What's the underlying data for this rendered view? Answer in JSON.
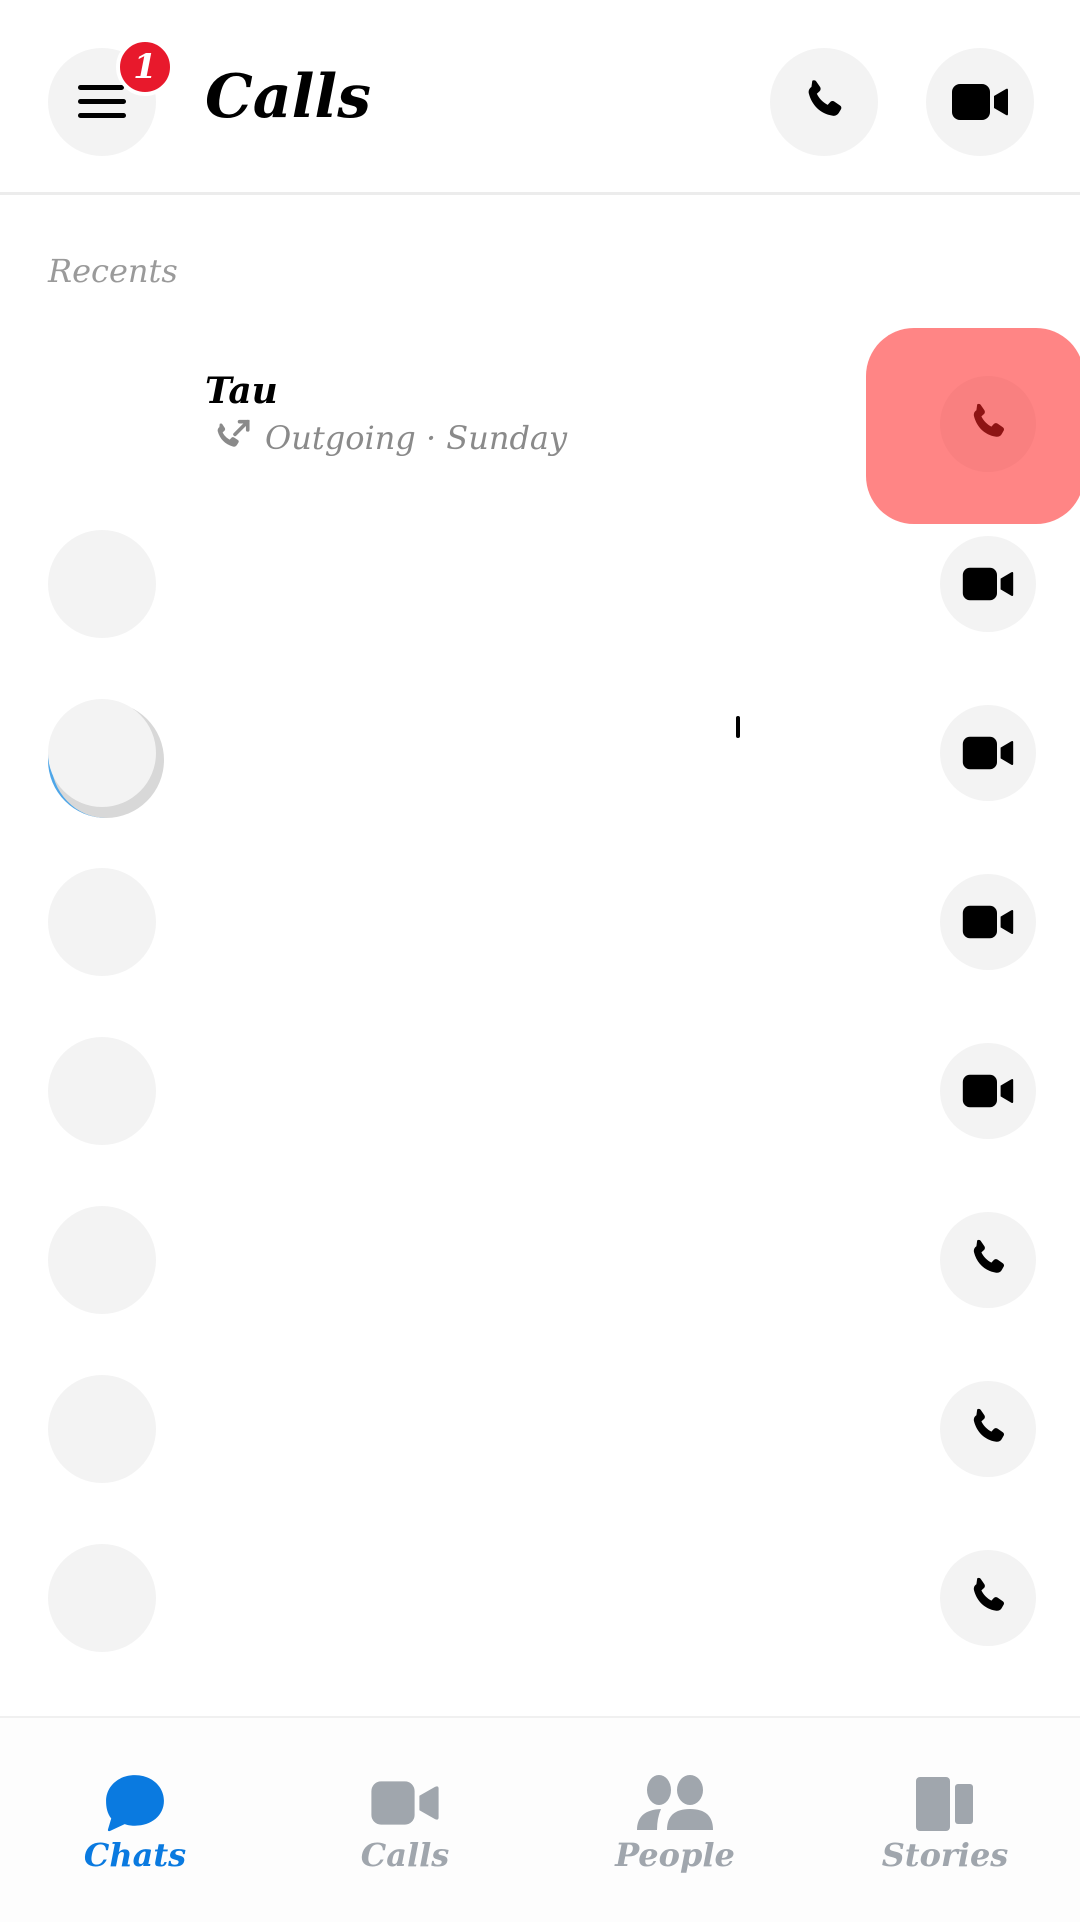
{
  "header": {
    "title": "Calls",
    "menu_badge": "1",
    "menu_icon": "hamburger-icon",
    "actions": [
      {
        "name": "new-audio-call",
        "icon": "phone-icon"
      },
      {
        "name": "new-video-call",
        "icon": "video-camera-icon"
      }
    ]
  },
  "section": {
    "label": "Recents"
  },
  "calls": [
    {
      "name": "Tau",
      "detail": "Outgoing · Sunday",
      "direction_icon": "outgoing-call-icon",
      "action_icon": "phone-icon",
      "highlighted": true
    },
    {
      "placeholder": true,
      "action_icon": "video-camera-icon"
    },
    {
      "placeholder": true,
      "action_icon": "video-camera-icon"
    },
    {
      "placeholder": true,
      "action_icon": "video-camera-icon"
    },
    {
      "placeholder": true,
      "action_icon": "video-camera-icon"
    },
    {
      "placeholder": true,
      "action_icon": "phone-icon"
    },
    {
      "placeholder": true,
      "action_icon": "phone-icon"
    },
    {
      "placeholder": true,
      "action_icon": "phone-icon"
    }
  ],
  "bottom_nav": {
    "active": "Chats",
    "tabs": [
      {
        "label": "Chats",
        "icon": "chat-bubble-icon"
      },
      {
        "label": "Calls",
        "icon": "video-camera-icon"
      },
      {
        "label": "People",
        "icon": "people-icon"
      },
      {
        "label": "Stories",
        "icon": "stories-icon"
      }
    ]
  },
  "colors": {
    "accent": "#0a7ae0",
    "badge": "#e8192c",
    "highlight": "#ff8585",
    "inactive_tab": "#a0a6ad"
  }
}
